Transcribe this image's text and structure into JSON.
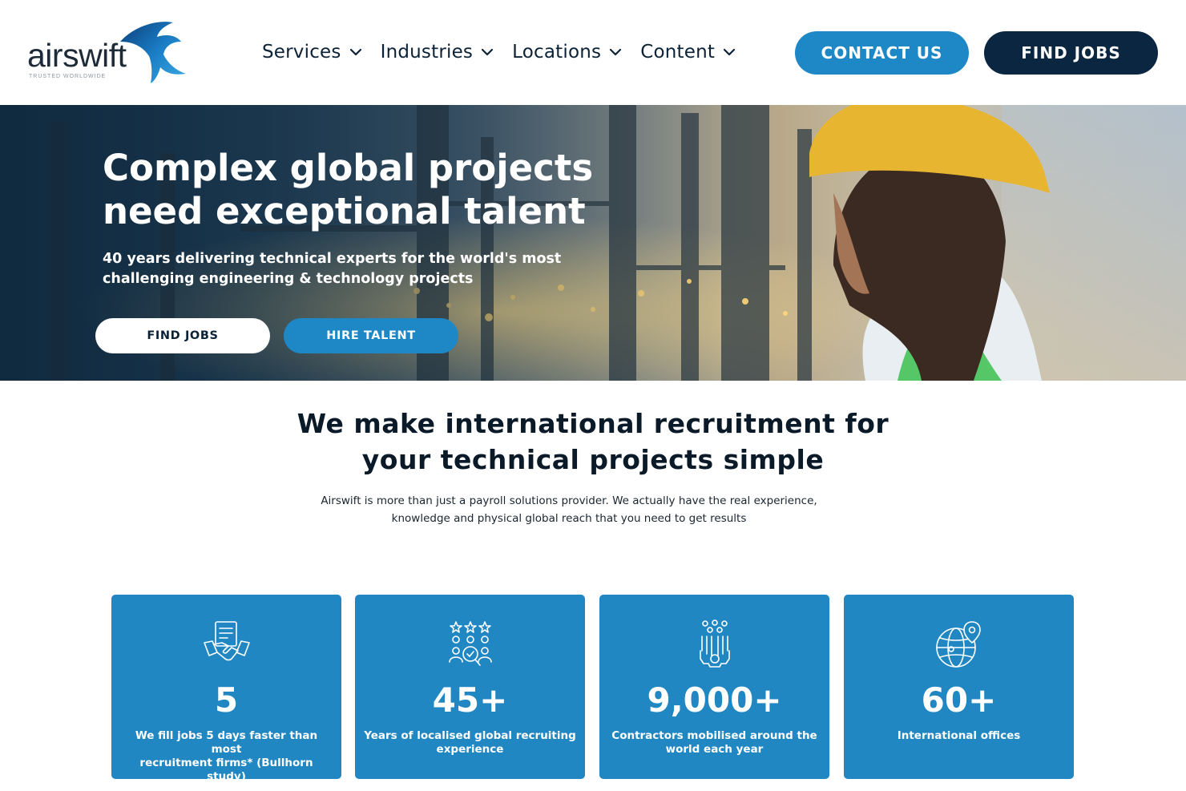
{
  "header": {
    "logo": {
      "wordmark": "airswift",
      "tagline": "TRUSTED WORLDWIDE"
    },
    "nav": [
      {
        "label": "Services",
        "icon": "chevron-down-icon"
      },
      {
        "label": "Industries",
        "icon": "chevron-down-icon"
      },
      {
        "label": "Locations",
        "icon": "chevron-down-icon"
      },
      {
        "label": "Content",
        "icon": "chevron-down-icon"
      }
    ],
    "contact_label": "CONTACT US",
    "find_jobs_label": "FIND JOBS"
  },
  "hero": {
    "title_line1": "Complex global projects",
    "title_line2": "need exceptional talent",
    "subtitle_line1": "40 years delivering technical experts for the world's most",
    "subtitle_line2": "challenging engineering & technology projects",
    "find_jobs_label": "FIND JOBS",
    "hire_talent_label": "HIRE TALENT"
  },
  "intro": {
    "title_line1": "We make international recruitment for",
    "title_line2": "your technical projects simple",
    "text_line1": "Airswift is more than just a payroll solutions provider. We actually have the real experience,",
    "text_line2": "knowledge and physical global reach that you need to get results"
  },
  "stats": [
    {
      "icon": "handshake-contract-icon",
      "value": "5",
      "label_line1": "We fill jobs 5 days faster than most",
      "label_line2": "recruitment firms* (Bullhorn study)"
    },
    {
      "icon": "rated-team-search-icon",
      "value": "45+",
      "label_line1": "Years of localised global recruiting",
      "label_line2": "experience"
    },
    {
      "icon": "workforce-gear-icon",
      "value": "9,000+",
      "label_line1": "Contractors mobilised around the",
      "label_line2": "world each year"
    },
    {
      "icon": "globe-location-pin-icon",
      "value": "60+",
      "label_line1": "International offices",
      "label_line2": ""
    }
  ],
  "colors": {
    "brand_blue": "#1e88c7",
    "navy": "#0a2640",
    "card_blue": "#2187c3"
  }
}
